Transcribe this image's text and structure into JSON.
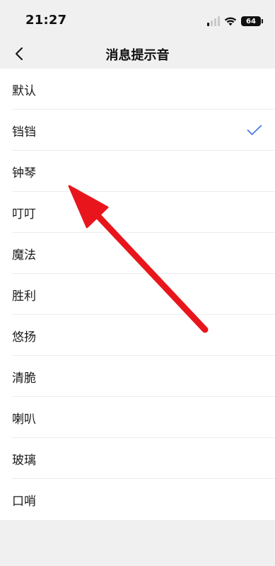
{
  "status_bar": {
    "time": "21:27",
    "battery": "64"
  },
  "nav": {
    "title": "消息提示音"
  },
  "sounds": [
    {
      "label": "默认",
      "selected": false
    },
    {
      "label": "铛铛",
      "selected": true
    },
    {
      "label": "钟琴",
      "selected": false
    },
    {
      "label": "叮叮",
      "selected": false
    },
    {
      "label": "魔法",
      "selected": false
    },
    {
      "label": "胜利",
      "selected": false
    },
    {
      "label": "悠扬",
      "selected": false
    },
    {
      "label": "清脆",
      "selected": false
    },
    {
      "label": "喇叭",
      "selected": false
    },
    {
      "label": "玻璃",
      "selected": false
    },
    {
      "label": "口哨",
      "selected": false
    }
  ],
  "colors": {
    "accent": "#3f72e6",
    "annotation": "#e8141c",
    "background": "#f0f0f0"
  }
}
